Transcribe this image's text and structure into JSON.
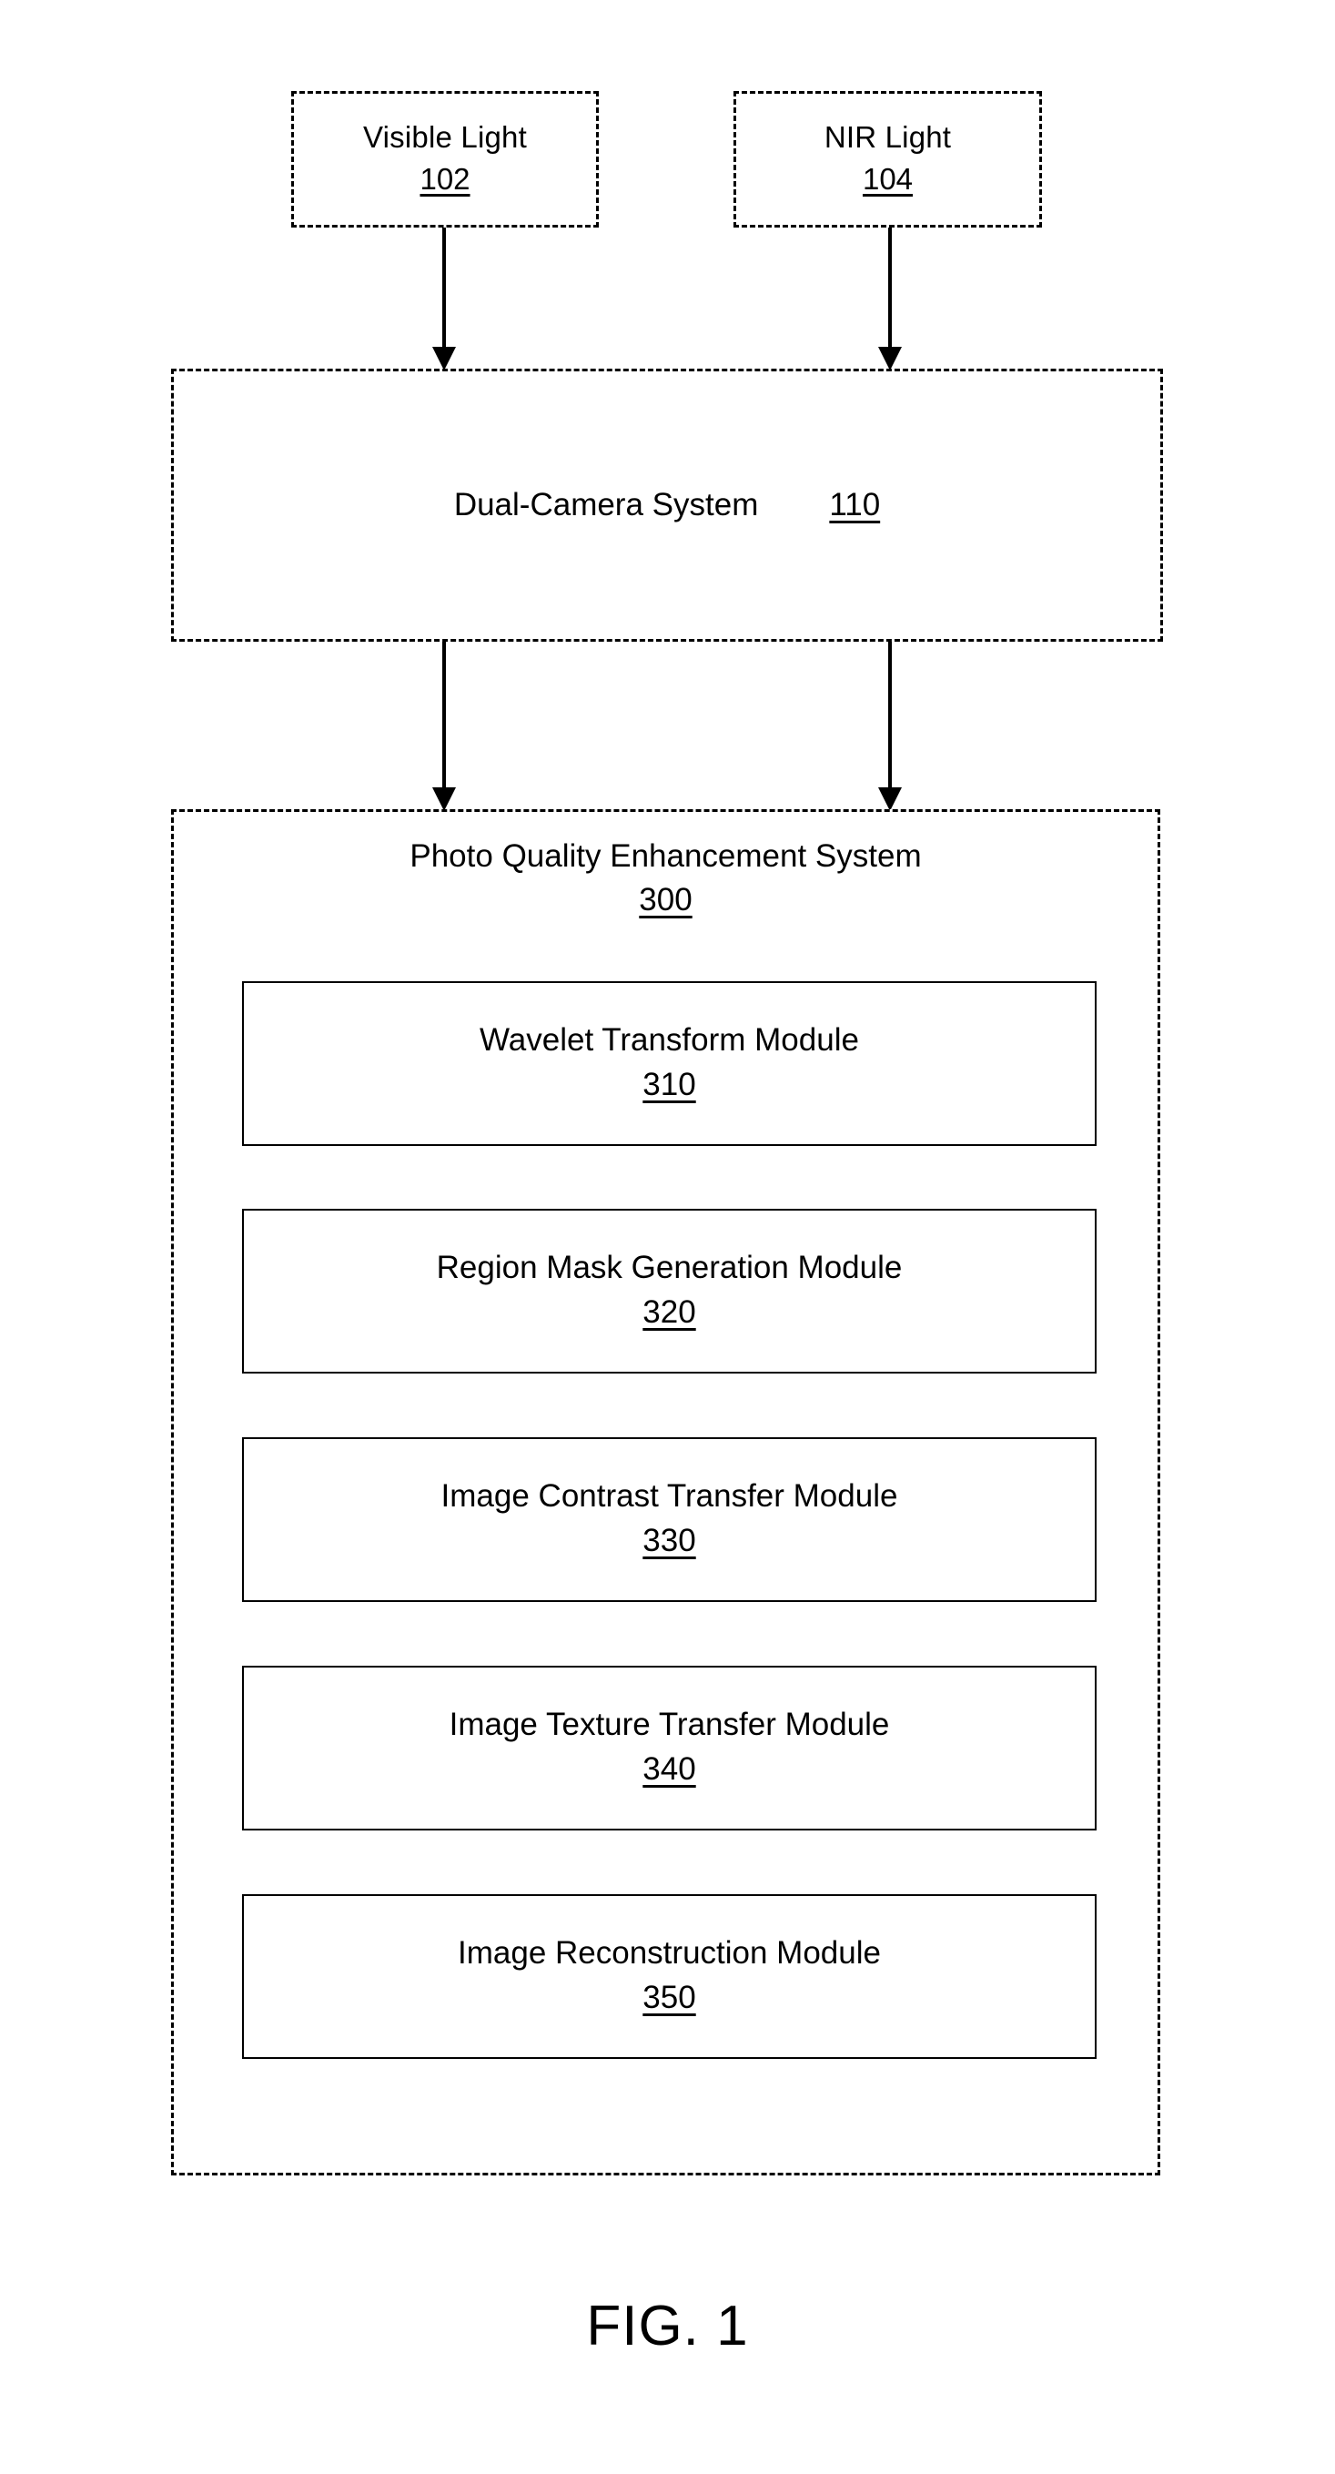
{
  "figure": {
    "caption": "FIG. 1"
  },
  "inputs": [
    {
      "id": "visible-light",
      "title": "Visible Light",
      "ref": "102"
    },
    {
      "id": "nir-light",
      "title": "NIR Light",
      "ref": "104"
    }
  ],
  "dual_camera_system": {
    "title": "Dual-Camera System",
    "ref": "110"
  },
  "photo_quality_system": {
    "title": "Photo Quality Enhancement System",
    "ref": "300",
    "modules": [
      {
        "title": "Wavelet Transform Module",
        "ref": "310"
      },
      {
        "title": "Region Mask Generation Module",
        "ref": "320"
      },
      {
        "title": "Image Contrast Transfer Module",
        "ref": "330"
      },
      {
        "title": "Image Texture Transfer Module",
        "ref": "340"
      },
      {
        "title": "Image Reconstruction Module",
        "ref": "350"
      }
    ]
  },
  "connectors": [
    {
      "id": "visible-to-dual-camera"
    },
    {
      "id": "nir-to-dual-camera"
    },
    {
      "id": "dual-camera-to-pq-left"
    },
    {
      "id": "dual-camera-to-pq-right"
    }
  ]
}
